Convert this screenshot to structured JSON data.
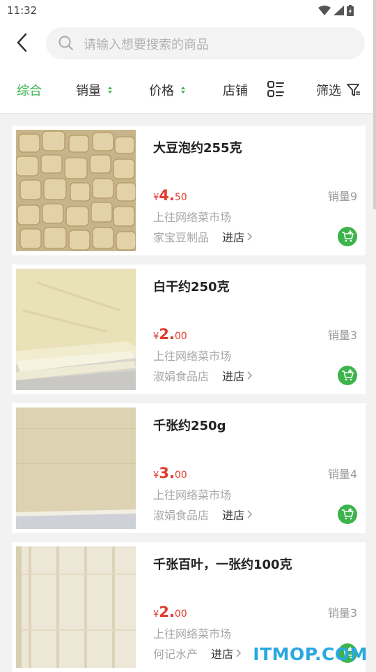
{
  "status": {
    "time": "11:32"
  },
  "search": {
    "placeholder": "请输入想要搜索的商品"
  },
  "filters": {
    "tabs": [
      "综合",
      "销量",
      "价格",
      "店铺",
      "筛选"
    ],
    "active_color": "#3cb44b"
  },
  "products": [
    {
      "name": "大豆泡约255克",
      "currency": "¥",
      "price_int": "4.",
      "price_dec": "50",
      "sales": "销量9",
      "market": "上往网络菜市场",
      "shop": "家宝豆制品",
      "enter": "进店",
      "image": "fried-tofu-puffs"
    },
    {
      "name": "白干约250克",
      "currency": "¥",
      "price_int": "2.",
      "price_dec": "00",
      "sales": "销量3",
      "market": "上往网络菜市场",
      "shop": "淑娟食品店",
      "enter": "进店",
      "image": "dried-tofu-stack"
    },
    {
      "name": "千张约250g",
      "currency": "¥",
      "price_int": "3.",
      "price_dec": "00",
      "sales": "销量4",
      "market": "上往网络菜市场",
      "shop": "淑娟食品店",
      "enter": "进店",
      "image": "tofu-skin-sheets"
    },
    {
      "name": "千张百叶，一张约100克",
      "currency": "¥",
      "price_int": "2.",
      "price_dec": "00",
      "sales": "销量3",
      "market": "上往网络菜市场",
      "shop": "何记水产",
      "enter": "进店",
      "image": "tofu-skin-sheets-white"
    }
  ],
  "watermark": "ITMOP.COM",
  "colors": {
    "price": "#e23b2e",
    "cart": "#3cb44b",
    "watermark": "#2aa8e0"
  }
}
